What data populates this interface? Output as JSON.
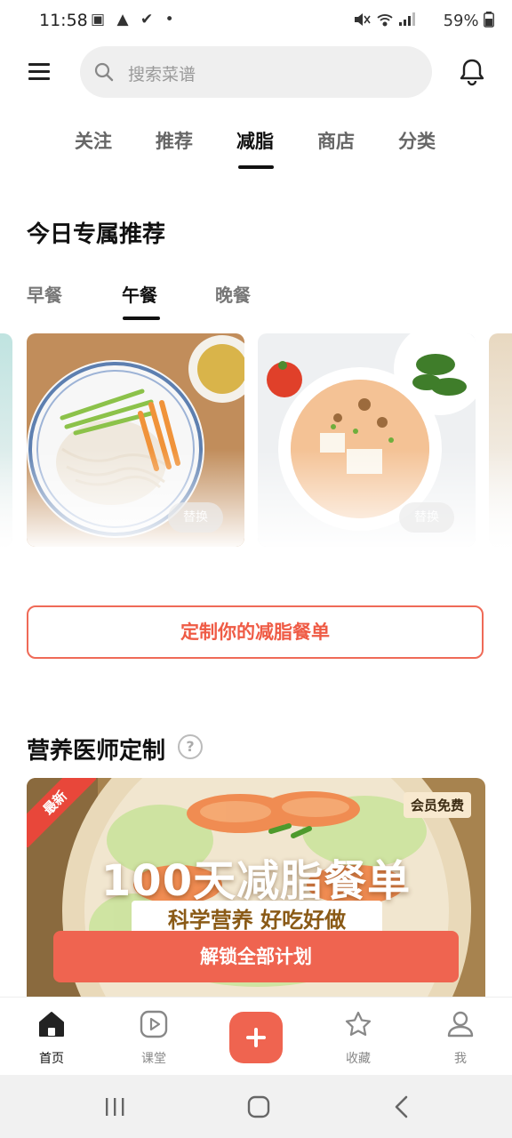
{
  "status_bar": {
    "time": "11:58",
    "left_icons": "▣ ▲ ✔ •",
    "battery": "59%"
  },
  "header": {
    "search_placeholder": "搜索菜谱"
  },
  "top_tabs": [
    "关注",
    "推荐",
    "减脂",
    "商店",
    "分类"
  ],
  "section_title": "今日专属推荐",
  "meal_tabs": [
    "早餐",
    "午餐",
    "晚餐"
  ],
  "cards": [
    {
      "swap_label": "替换"
    },
    {
      "swap_label": "替换"
    }
  ],
  "custom_button": "定制你的减脂餐单",
  "nutrition": {
    "title": "营养医师定制",
    "help_icon": "?",
    "badge_new": "最新",
    "badge_vip": "会员免费",
    "banner_title": "100天减脂餐单",
    "banner_subtitle": "科学营养 好吃好做",
    "unlock_button": "解锁全部计划"
  },
  "bottom_nav": [
    {
      "label": "首页",
      "icon": "home-icon"
    },
    {
      "label": "课堂",
      "icon": "play-icon"
    },
    {
      "label": "",
      "icon": "plus-icon"
    },
    {
      "label": "收藏",
      "icon": "star-icon"
    },
    {
      "label": "我",
      "icon": "user-icon"
    }
  ],
  "colors": {
    "accent": "#ef6450",
    "active_tab": "#111111",
    "inactive_tab": "#666666"
  }
}
